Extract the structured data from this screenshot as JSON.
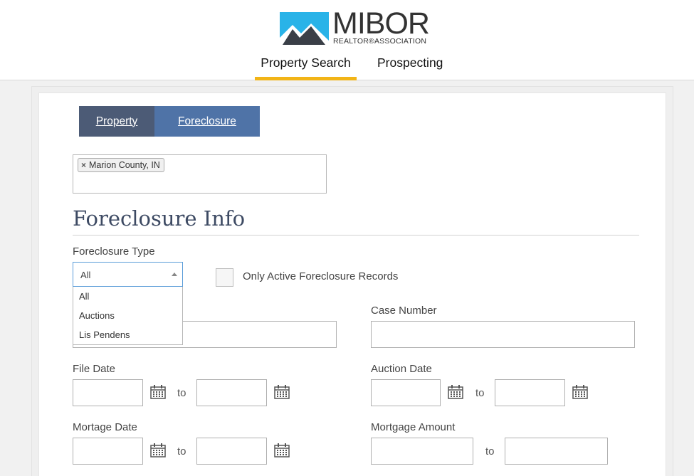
{
  "brand": {
    "name": "MIBOR",
    "subtitle": "REALTOR®ASSOCIATION",
    "mark_color": "#29b3e8"
  },
  "nav": {
    "tabs": [
      {
        "label": "Property Search",
        "active": true
      },
      {
        "label": "Prospecting",
        "active": false
      }
    ],
    "active_color": "#f2b416"
  },
  "subtabs": [
    {
      "label": "Property",
      "active": false
    },
    {
      "label": "Foreclosure",
      "active": true
    }
  ],
  "location_tags": [
    {
      "label": "Marion County, IN",
      "remove_glyph": "×"
    }
  ],
  "section": {
    "title": "Foreclosure Info"
  },
  "foreclosure_type": {
    "label": "Foreclosure Type",
    "selected": "All",
    "options": [
      "All",
      "Auctions",
      "Lis Pendens"
    ]
  },
  "active_only": {
    "label": "Only Active Foreclosure Records",
    "checked": false
  },
  "case_number": {
    "label": "Case Number",
    "value": ""
  },
  "file_date": {
    "label": "File Date",
    "from": "",
    "to": "",
    "separator": "to",
    "icon": "calendar-icon"
  },
  "auction_date": {
    "label": "Auction Date",
    "from": "",
    "to": "",
    "separator": "to",
    "icon": "calendar-icon"
  },
  "mortgage_date": {
    "label": "Mortage Date",
    "from": "",
    "to": "",
    "separator": "to",
    "icon": "calendar-icon"
  },
  "mortgage_amount": {
    "label": "Mortgage Amount",
    "from": "",
    "to": "",
    "separator": "to"
  },
  "colors": {
    "subtab_inactive": "#4c5b76",
    "subtab_active": "#4f73a7",
    "heading": "#3d4a63"
  }
}
